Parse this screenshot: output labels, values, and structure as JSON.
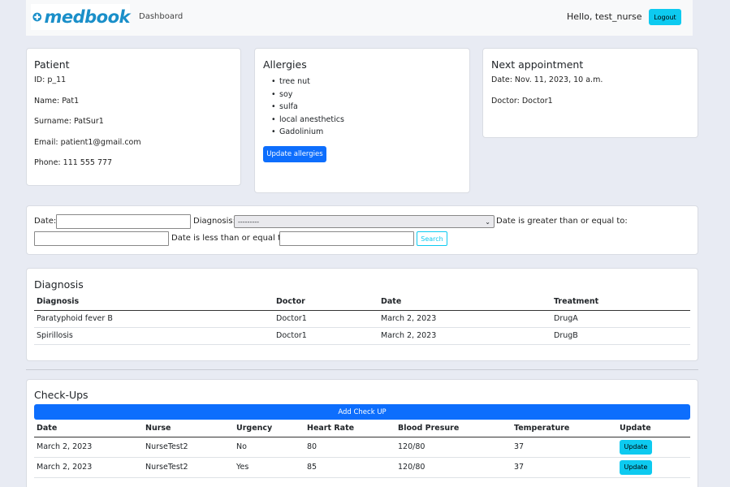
{
  "navbar": {
    "brand": "medbook",
    "dashboard_link": "Dashboard",
    "greeting": "Hello, test_nurse",
    "logout_label": "Logout",
    "brand_color": "#1a8fc9"
  },
  "patient": {
    "title": "Patient",
    "id": "ID: p_11",
    "name": "Name: Pat1",
    "surname": "Surname: PatSur1",
    "email": "Email: patient1@gmail.com",
    "phone": "Phone: 111 555 777"
  },
  "allergies": {
    "title": "Allergies",
    "items": [
      "tree nut",
      "soy",
      "sulfa",
      "local anesthetics",
      "Gadolinium"
    ],
    "update_label": "Update allergies"
  },
  "appointment": {
    "title": "Next appointment",
    "date": "Date: Nov. 11, 2023, 10 a.m.",
    "doctor": "Doctor: Doctor1"
  },
  "filter": {
    "date_label": "Date:",
    "date_value": "",
    "diagnosis_label": "Diagnosis:",
    "diagnosis_selected": "---------",
    "date_gte_label": "Date is greater than or equal to:",
    "date_gte_value": "",
    "date_lte_label": "Date is less than or equal to:",
    "date_lte_value": "",
    "search_label": "Search"
  },
  "diagnosis": {
    "title": "Diagnosis",
    "columns": [
      "Diagnosis",
      "Doctor",
      "Date",
      "Treatment"
    ],
    "rows": [
      [
        "Paratyphoid fever B",
        "Doctor1",
        "March 2, 2023",
        "DrugA"
      ],
      [
        "Spirillosis",
        "Doctor1",
        "March 2, 2023",
        "DrugB"
      ]
    ]
  },
  "checkups": {
    "title": "Check-Ups",
    "add_label": "Add Check UP",
    "columns": [
      "Date",
      "Nurse",
      "Urgency",
      "Heart Rate",
      "Blood Presure",
      "Temperature",
      "Update"
    ],
    "rows": [
      [
        "March 2, 2023",
        "NurseTest2",
        "No",
        "80",
        "120/80",
        "37"
      ],
      [
        "March 2, 2023",
        "NurseTest2",
        "Yes",
        "85",
        "120/80",
        "37"
      ]
    ],
    "update_label": "Update"
  }
}
